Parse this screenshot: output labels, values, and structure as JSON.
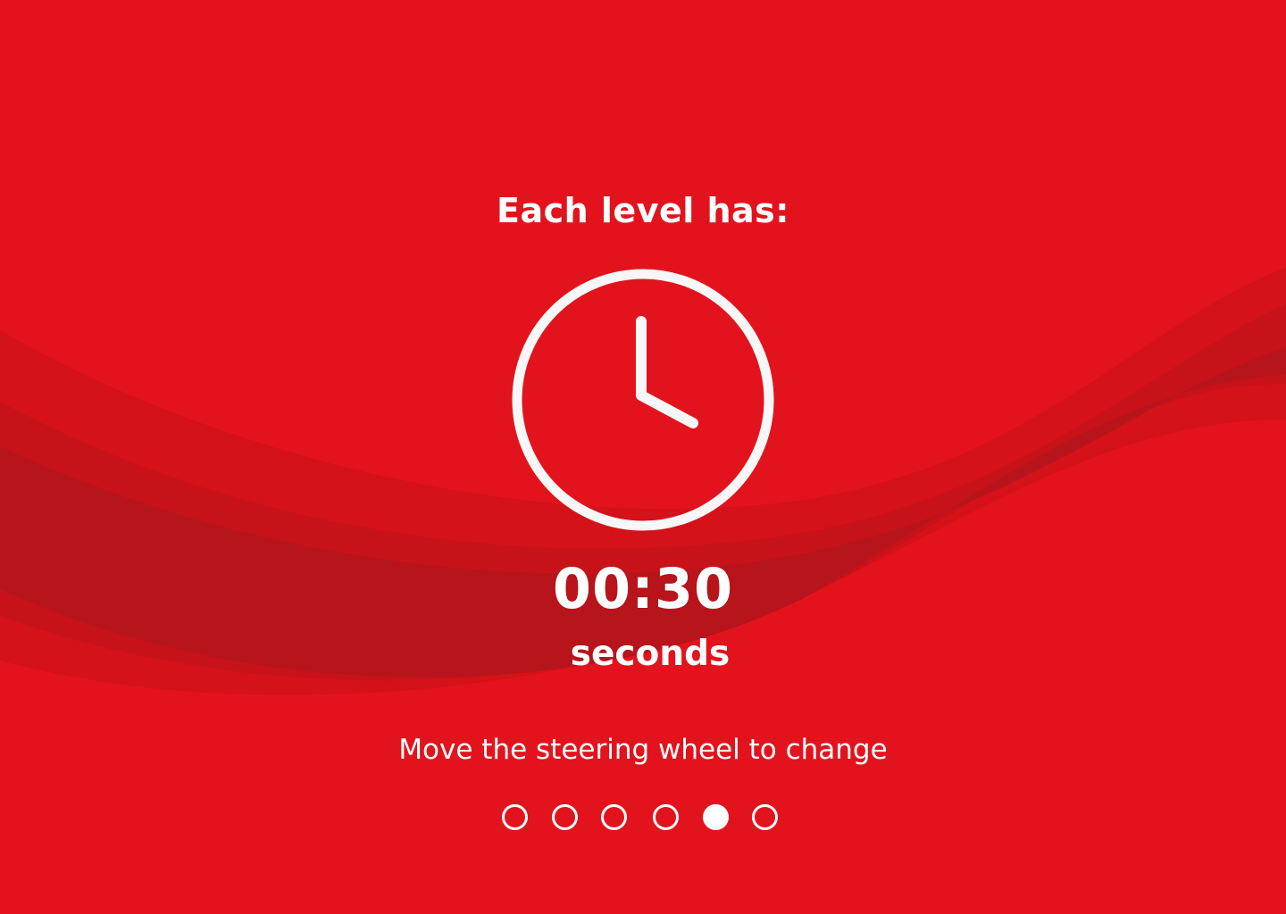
{
  "colors": {
    "background": "#e3131d",
    "foreground": "#ffffff",
    "wave_dark": "#b8141b"
  },
  "intro": {
    "headline": "Each level has:",
    "icon": "clock-icon"
  },
  "timer": {
    "value": "00:30",
    "unit": "seconds"
  },
  "instruction": "Move the steering wheel to change",
  "pager": {
    "total_pages": 6,
    "active_page": 5
  }
}
